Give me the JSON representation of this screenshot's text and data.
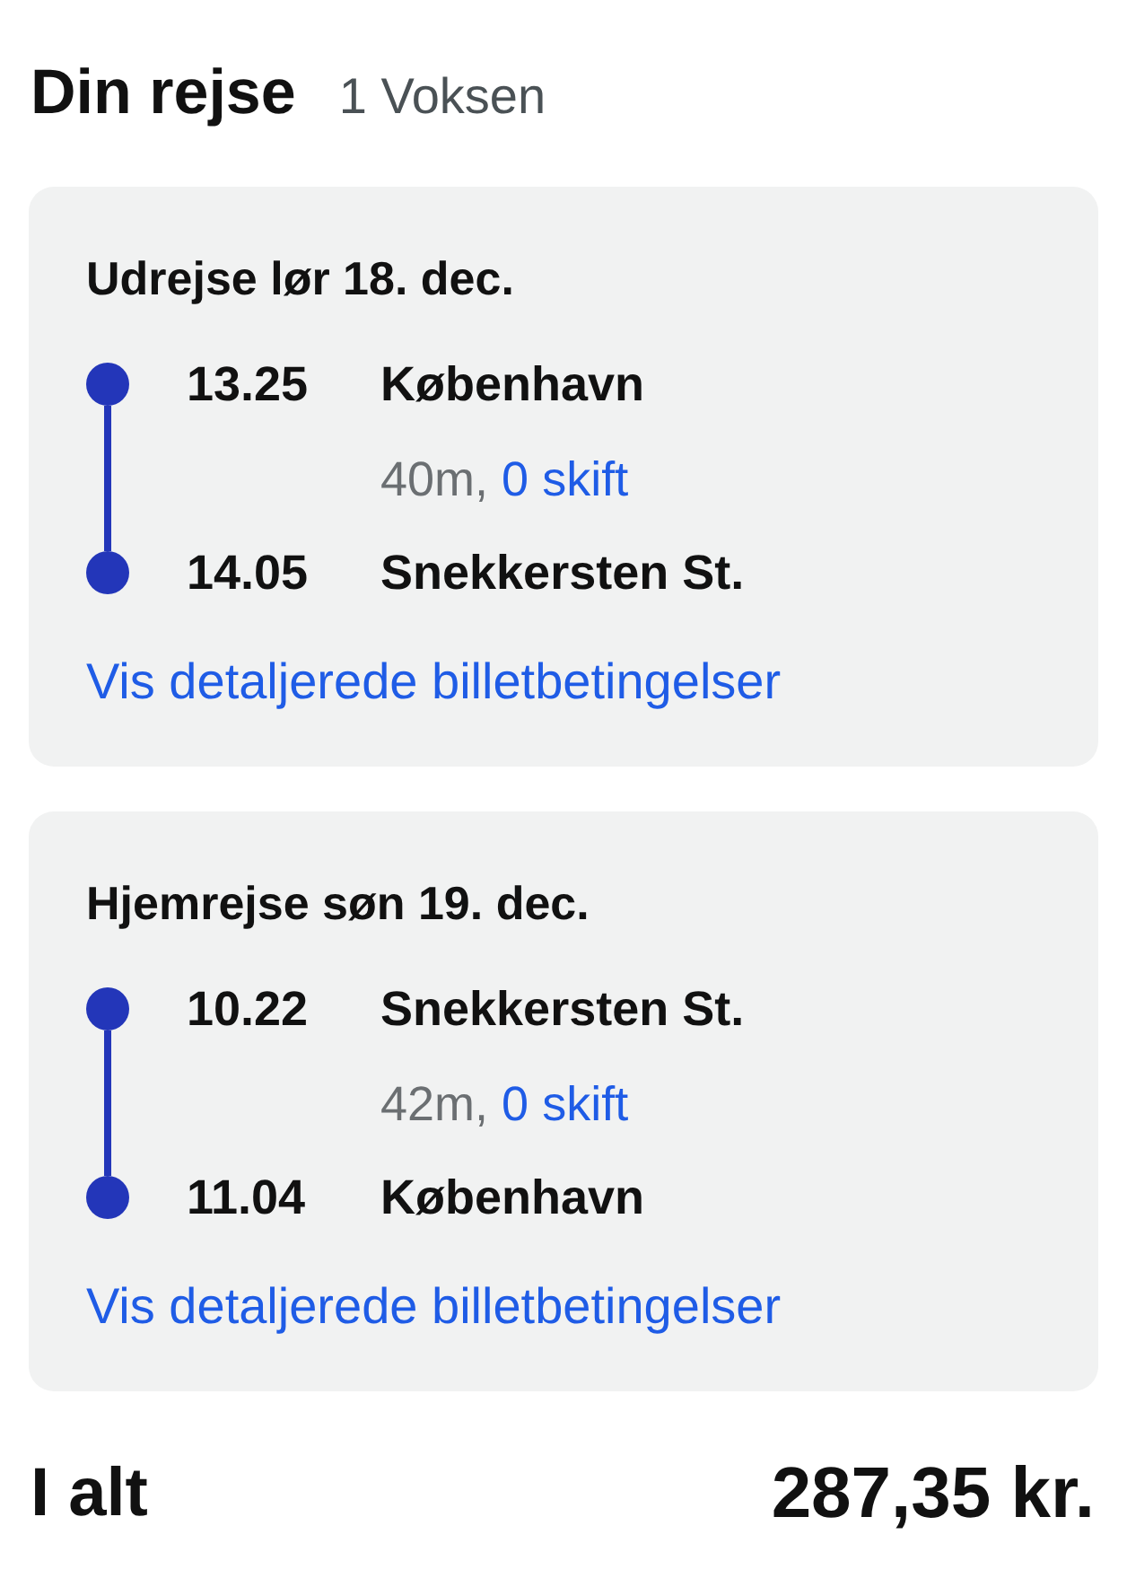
{
  "header": {
    "title": "Din rejse",
    "passengers": "1 Voksen"
  },
  "journeys": [
    {
      "title": "Udrejse lør 18. dec.",
      "stops": [
        {
          "time": "13.25",
          "station": "København"
        },
        {
          "time": "14.05",
          "station": "Snekkersten St."
        }
      ],
      "duration": "40m,",
      "changes": "0 skift",
      "link": "Vis detaljerede billetbetingelser"
    },
    {
      "title": "Hjemrejse søn 19. dec.",
      "stops": [
        {
          "time": "10.22",
          "station": "Snekkersten St."
        },
        {
          "time": "11.04",
          "station": "København"
        }
      ],
      "duration": "42m,",
      "changes": "0 skift",
      "link": "Vis detaljerede billetbetingelser"
    }
  ],
  "total": {
    "label": "I alt",
    "amount": "287,35 kr."
  }
}
